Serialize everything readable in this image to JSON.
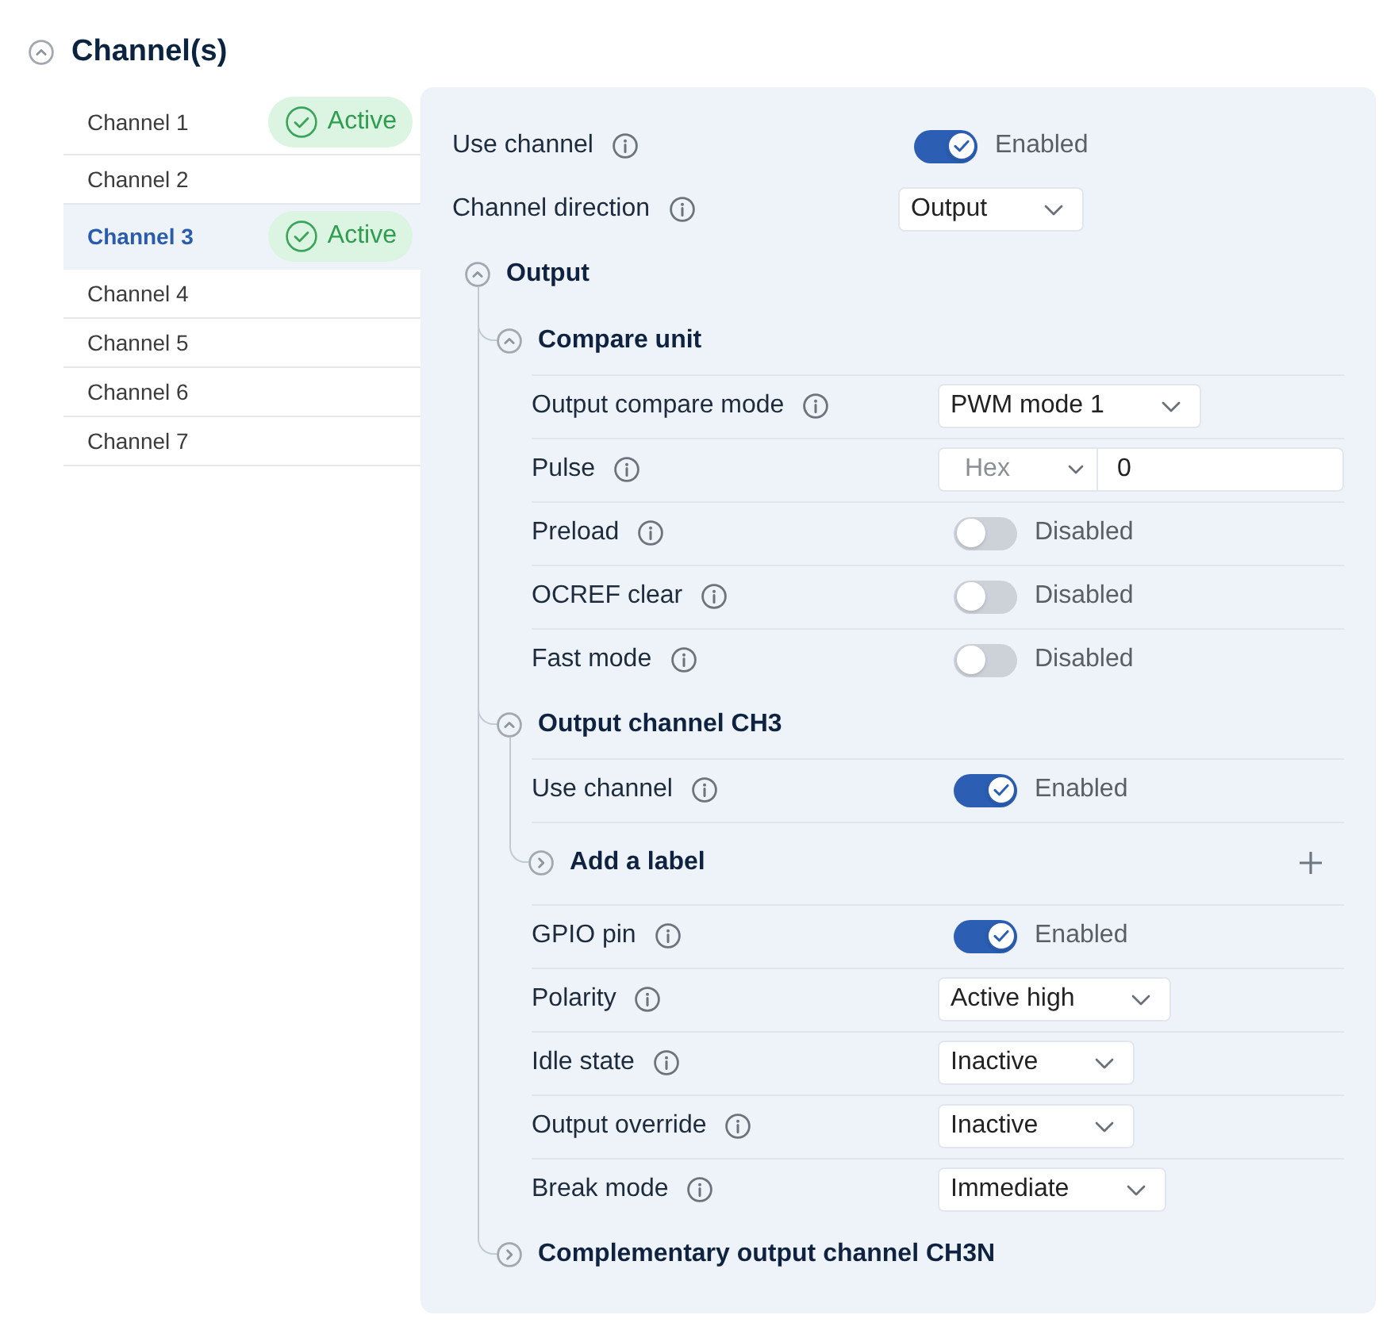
{
  "section": {
    "title": "Channel(s)",
    "expanded": true
  },
  "channels": [
    {
      "name": "Channel 1",
      "selected": false,
      "badge": "Active"
    },
    {
      "name": "Channel 2",
      "selected": false
    },
    {
      "name": "Channel 3",
      "selected": true,
      "badge": "Active"
    },
    {
      "name": "Channel 4",
      "selected": false
    },
    {
      "name": "Channel 5",
      "selected": false
    },
    {
      "name": "Channel 6",
      "selected": false
    },
    {
      "name": "Channel 7",
      "selected": false
    }
  ],
  "settings": [
    {
      "kind": "toggle",
      "label": "Use channel",
      "on": true,
      "status": "Enabled"
    },
    {
      "kind": "select",
      "label": "Channel direction",
      "value": "Output"
    },
    {
      "kind": "group",
      "title": "Output",
      "expanded": true,
      "items": [
        {
          "kind": "group",
          "title": "Compare unit",
          "expanded": true,
          "items": [
            {
              "kind": "select",
              "label": "Output compare mode",
              "value": "PWM mode 1"
            },
            {
              "kind": "number",
              "label": "Pulse",
              "format": "Hex",
              "value": "0"
            },
            {
              "kind": "toggle",
              "label": "Preload",
              "on": false,
              "status": "Disabled"
            },
            {
              "kind": "toggle",
              "label": "OCREF clear",
              "on": false,
              "status": "Disabled"
            },
            {
              "kind": "toggle",
              "label": "Fast mode",
              "on": false,
              "status": "Disabled"
            }
          ]
        },
        {
          "kind": "group",
          "title": "Output channel CH3",
          "expanded": true,
          "items": [
            {
              "kind": "toggle",
              "label": "Use channel",
              "on": true,
              "status": "Enabled"
            },
            {
              "kind": "group",
              "title": "Add a label",
              "expanded": false,
              "addable": true
            },
            {
              "kind": "toggle",
              "label": "GPIO pin",
              "on": true,
              "status": "Enabled"
            },
            {
              "kind": "select",
              "label": "Polarity",
              "value": "Active high"
            },
            {
              "kind": "select",
              "label": "Idle state",
              "value": "Inactive"
            },
            {
              "kind": "select",
              "label": "Output override",
              "value": "Inactive"
            },
            {
              "kind": "select",
              "label": "Break mode",
              "value": "Immediate"
            }
          ]
        },
        {
          "kind": "group",
          "title": "Complementary output channel CH3N",
          "expanded": false
        }
      ]
    }
  ]
}
